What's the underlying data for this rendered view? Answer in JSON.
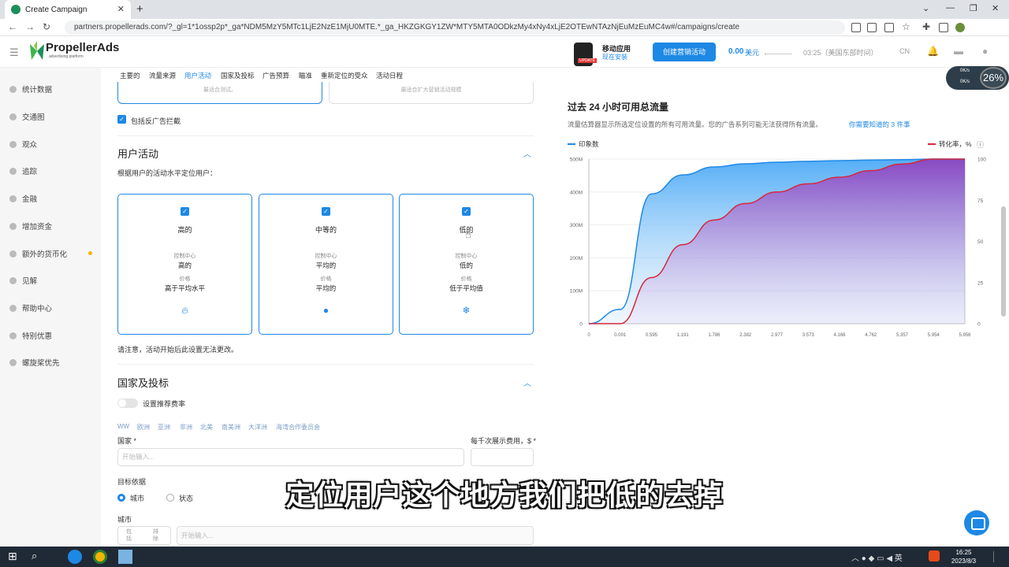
{
  "browser": {
    "tab_title": "Create Campaign",
    "url": "partners.propellerads.com/?_gl=1*1ossp2p*_ga*NDM5MzY5MTc1LjE2NzE1MjU0MTE.*_ga_HKZGKGY1ZW*MTY5MTA0ODkzMy4xNy4xLjE2OTEwNTAzNjEuMzEuMC4w#/campaigns/create",
    "update_label": "更新"
  },
  "header": {
    "logo": "PropellerAds",
    "logo_sub": "advertising platform",
    "phone_badge": "UPDATE",
    "mobile_title": "移动应用",
    "mobile_link": "现在安装",
    "create_button": "创建营销活动",
    "balance": "0.00",
    "balance_unit": "美元",
    "clock": "03:25（美国东部时间）",
    "language": "CN"
  },
  "sidebar": {
    "items": [
      {
        "label": "统计数据",
        "icon": "stats-icon"
      },
      {
        "label": "交通图",
        "icon": "traffic-map-icon"
      },
      {
        "label": "观众",
        "icon": "audience-icon"
      },
      {
        "label": "追踪",
        "icon": "tracking-icon"
      },
      {
        "label": "金融",
        "icon": "finance-icon"
      },
      {
        "label": "增加资金",
        "icon": "add-funds-icon"
      },
      {
        "label": "额外的货币化",
        "icon": "monetization-icon"
      },
      {
        "label": "见解",
        "icon": "insights-icon"
      },
      {
        "label": "帮助中心",
        "icon": "help-icon"
      },
      {
        "label": "特别优惠",
        "icon": "offers-icon"
      },
      {
        "label": "螺旋桨优先",
        "icon": "star-icon"
      }
    ]
  },
  "subnav": [
    "主要的",
    "流量来源",
    "用户活动",
    "国家及投标",
    "广告预算",
    "瞄准",
    "重新定位的受众",
    "活动日程"
  ],
  "top_cards": [
    "最适合测试。",
    "最适合扩大营销活动规模"
  ],
  "antiadblock_label": "包括反广告拦截",
  "activity": {
    "title": "用户活动",
    "desc": "根据用户的活动水平定位用户：",
    "cards": [
      {
        "title": "高的",
        "k1": "控制中心",
        "v1": "高的",
        "k2": "价格",
        "v2": "高于平均水平",
        "icon": "fire-icon"
      },
      {
        "title": "中等的",
        "k1": "控制中心",
        "v1": "平均的",
        "k2": "价格",
        "v2": "平均的",
        "icon": "user-icon"
      },
      {
        "title": "低的",
        "k1": "控制中心",
        "v1": "低的",
        "k2": "价格",
        "v2": "低于平均值",
        "icon": "snowflake-icon"
      }
    ],
    "note": "请注意，活动开始后此设置无法更改。"
  },
  "countries": {
    "title": "国家及投标",
    "toggle_label": "设置推荐费率",
    "regions": [
      "WW",
      "欧洲",
      "亚洲",
      "非洲",
      "北美",
      "南美洲",
      "大洋洲",
      "海湾合作委员会"
    ],
    "country_label": "国家 *",
    "country_placeholder": "开始输入...",
    "cpm_label": "每千次展示费用，$ *",
    "target_label": "目标依据",
    "radio_city": "城市",
    "radio_state": "状态",
    "city_label": "城市",
    "include": "包括",
    "exclude": "排除",
    "city_placeholder": "开始输入..."
  },
  "traffic": {
    "title": "过去 24 小时可用总流量",
    "desc": "流量估算器显示所选定位设置的所有可用流量。您的广告系列可能无法获得所有流量。",
    "link": "你需要知道的 3 件事"
  },
  "chart_data": {
    "type": "area",
    "x": [
      0,
      0.001,
      0.595,
      1.191,
      1.786,
      2.382,
      2.977,
      3.573,
      4.168,
      4.762,
      5.357,
      5.954,
      5.956
    ],
    "series": [
      {
        "name": "印象数",
        "axis": "left",
        "color": "#1e88e5",
        "values": [
          0,
          45,
          410,
          470,
          495,
          505,
          510,
          513,
          515,
          517,
          518,
          520,
          520
        ]
      },
      {
        "name": "转化率，%",
        "axis": "right",
        "color": "#d7263d",
        "values": [
          0,
          0,
          28,
          48,
          63,
          73,
          80,
          85,
          89,
          93,
          97,
          100,
          100
        ]
      }
    ],
    "x_ticks": [
      "0",
      "0.001",
      "0.595",
      "1.191",
      "1.786",
      "2.382",
      "2.977",
      "3.573",
      "4.168",
      "4.762",
      "5.357",
      "5.954",
      "5.956"
    ],
    "y_left_ticks": [
      "0",
      "100M",
      "200M",
      "300M",
      "400M",
      "500M"
    ],
    "y_right_ticks": [
      "0",
      "25",
      "50",
      "75",
      "100"
    ],
    "ylim_left": [
      0,
      520
    ],
    "ylim_right": [
      0,
      100
    ],
    "legend_left": "印象数",
    "legend_right": "转化率，%"
  },
  "speed_widget": {
    "up": "0K/s",
    "down": "0K/s",
    "percent": "26%"
  },
  "subtitle": "定位用户这个地方我们把低的去掉",
  "taskbar": {
    "ime": "英",
    "time": "16:25",
    "date": "2023/8/3"
  }
}
